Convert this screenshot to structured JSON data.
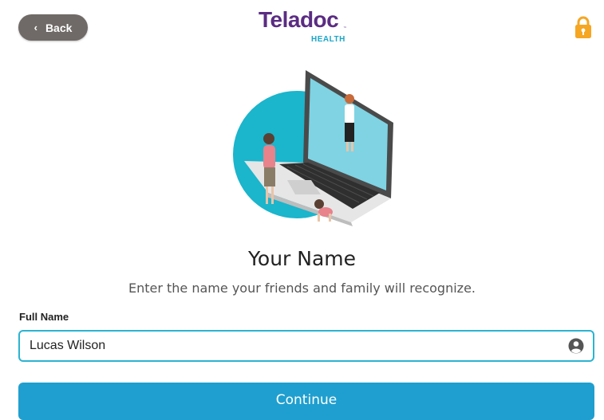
{
  "header": {
    "back_label": "Back",
    "logo_text": "Teladoc",
    "logo_sub": "HEALTH",
    "logo_tm": "™"
  },
  "main": {
    "title": "Your Name",
    "subtitle": "Enter the name your friends and family will recognize."
  },
  "form": {
    "full_name_label": "Full Name",
    "full_name_value": "Lucas Wilson"
  },
  "actions": {
    "continue_label": "Continue"
  },
  "icons": {
    "back": "chevron-left-icon",
    "lock": "lock-icon",
    "user": "user-circle-icon"
  },
  "colors": {
    "brand_purple": "#5b2c83",
    "brand_teal": "#1aa6c9",
    "accent_blue": "#1f9fcf",
    "input_border": "#2bb3d1",
    "lock_orange": "#f5a623",
    "back_button": "#6f6a67",
    "hero_circle": "#1bb5cc"
  }
}
